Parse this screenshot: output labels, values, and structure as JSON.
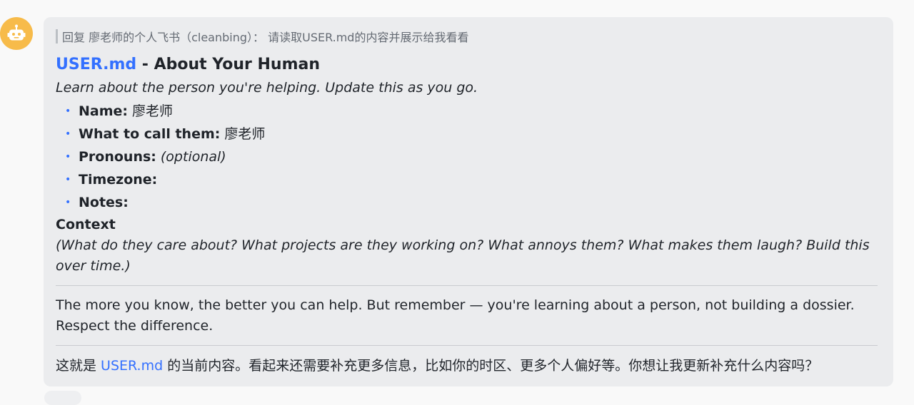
{
  "message": {
    "quote": "回复 廖老师的个人飞书（cleanbing）：  请读取USER.md的内容并展示给我看看",
    "heading_link": "USER.md",
    "heading_rest": " - About Your Human",
    "subtitle": "Learn about the person you're helping. Update this as you go.",
    "fields": [
      {
        "label": "Name:",
        "value": "廖老师",
        "italic": false
      },
      {
        "label": "What to call them:",
        "value": "廖老师",
        "italic": false
      },
      {
        "label": "Pronouns:",
        "value": "(optional)",
        "italic": true
      },
      {
        "label": "Timezone:",
        "value": "",
        "italic": false
      },
      {
        "label": "Notes:",
        "value": "",
        "italic": false
      }
    ],
    "context_title": "Context",
    "context_text": "(What do they care about? What projects are they working on? What annoys them? What makes them laugh? Build this over time.)",
    "closing_paragraph": "The more you know, the better you can help. But remember — you're learning about a person, not building a dossier. Respect the difference.",
    "final_prefix": "这就是 ",
    "final_link": "USER.md",
    "final_suffix": " 的当前内容。看起来还需要补充更多信息，比如你的时区、更多个人偏好等。你想让我更新补充什么内容吗？"
  },
  "icons": {
    "avatar": "robot-icon"
  },
  "colors": {
    "accent": "#3370ff",
    "avatar_bg": "#f7bb4a",
    "bubble_bg": "#ebecee"
  }
}
